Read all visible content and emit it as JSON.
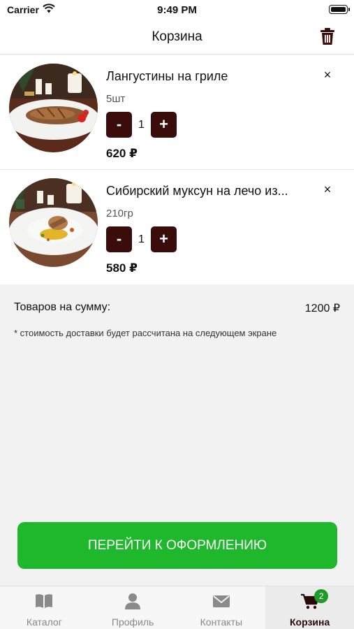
{
  "status_bar": {
    "carrier": "Carrier",
    "time": "9:49 PM"
  },
  "header": {
    "title": "Корзина"
  },
  "cart": {
    "items": [
      {
        "name": "Лангустины на гриле",
        "weight": "5шт",
        "quantity": "1",
        "price": "620 ₽",
        "minus_label": "-",
        "plus_label": "+",
        "remove_label": "×"
      },
      {
        "name": "Сибирский муксун на лечо из...",
        "weight": "210гр",
        "quantity": "1",
        "price": "580 ₽",
        "minus_label": "-",
        "plus_label": "+",
        "remove_label": "×"
      }
    ]
  },
  "summary": {
    "label": "Товаров на сумму:",
    "total": "1200 ₽",
    "note": "* стоимость доставки будет рассчитана на следующем экране"
  },
  "checkout": {
    "label": "ПЕРЕЙТИ К ОФОРМЛЕНИЮ"
  },
  "tabs": [
    {
      "label": "Каталог",
      "icon": "book-icon"
    },
    {
      "label": "Профиль",
      "icon": "person-icon"
    },
    {
      "label": "Контакты",
      "icon": "envelope-icon"
    },
    {
      "label": "Корзина",
      "icon": "cart-icon",
      "badge": "2",
      "active": true
    }
  ],
  "colors": {
    "accent": "#1fb82d",
    "qty_button": "#3a0d0a",
    "badge": "#1e9b27"
  }
}
